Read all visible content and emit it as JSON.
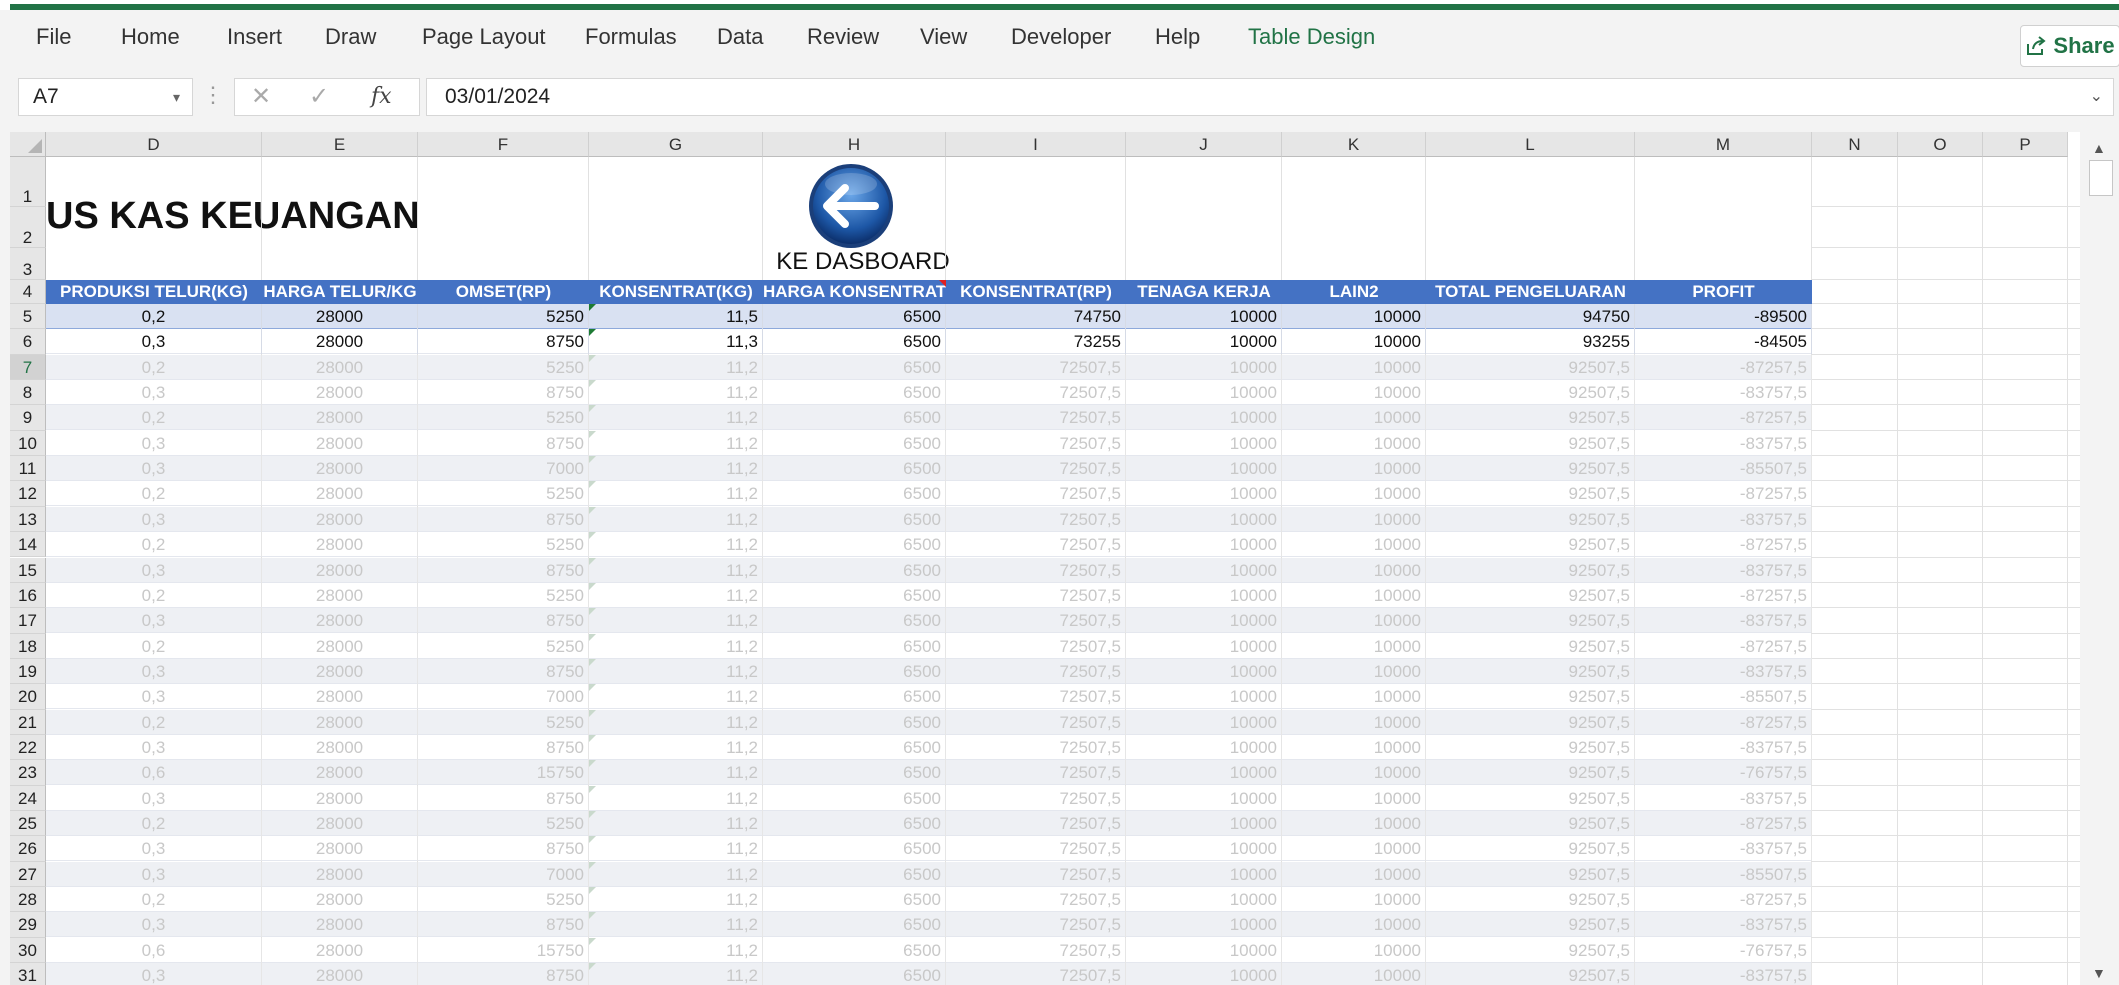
{
  "ribbon": {
    "tabs": [
      "File",
      "Home",
      "Insert",
      "Draw",
      "Page Layout",
      "Formulas",
      "Data",
      "Review",
      "View",
      "Developer",
      "Help",
      "Table Design"
    ],
    "share_label": "Share",
    "accent": "#217346"
  },
  "formula_bar": {
    "name_box": "A7",
    "fx": "fx",
    "formula": "03/01/2024"
  },
  "columns": [
    "D",
    "E",
    "F",
    "G",
    "H",
    "I",
    "J",
    "K",
    "L",
    "M",
    "N",
    "O",
    "P"
  ],
  "sheet": {
    "title": "US KAS KEUANGAN",
    "dashboard_button_label": "KE DASBOARD",
    "headers": [
      "PRODUKSI TELUR(KG)",
      "HARGA TELUR/KG",
      "OMSET(RP)",
      "KONSENTRAT(KG)",
      "HARGA KONSENTRAT",
      "KONSENTRAT(RP)",
      "TENAGA KERJA",
      "LAIN2",
      "TOTAL PENGELUARAN",
      "PROFIT"
    ],
    "rows": [
      {
        "n": "1"
      },
      {
        "n": "2"
      },
      {
        "n": "3"
      },
      {
        "n": "4"
      },
      {
        "n": "5",
        "v": [
          "0,2",
          "28000",
          "5250",
          "11,5",
          "6500",
          "74750",
          "10000",
          "10000",
          "94750",
          "-89500"
        ]
      },
      {
        "n": "6",
        "v": [
          "0,3",
          "28000",
          "8750",
          "11,3",
          "6500",
          "73255",
          "10000",
          "10000",
          "93255",
          "-84505"
        ]
      },
      {
        "n": "7",
        "v": [
          "0,2",
          "28000",
          "5250",
          "11,2",
          "6500",
          "72507,5",
          "10000",
          "10000",
          "92507,5",
          "-87257,5"
        ]
      },
      {
        "n": "8",
        "v": [
          "0,3",
          "28000",
          "8750",
          "11,2",
          "6500",
          "72507,5",
          "10000",
          "10000",
          "92507,5",
          "-83757,5"
        ]
      },
      {
        "n": "9",
        "v": [
          "0,2",
          "28000",
          "5250",
          "11,2",
          "6500",
          "72507,5",
          "10000",
          "10000",
          "92507,5",
          "-87257,5"
        ]
      },
      {
        "n": "10",
        "v": [
          "0,3",
          "28000",
          "8750",
          "11,2",
          "6500",
          "72507,5",
          "10000",
          "10000",
          "92507,5",
          "-83757,5"
        ]
      },
      {
        "n": "11",
        "v": [
          "0,3",
          "28000",
          "7000",
          "11,2",
          "6500",
          "72507,5",
          "10000",
          "10000",
          "92507,5",
          "-85507,5"
        ]
      },
      {
        "n": "12",
        "v": [
          "0,2",
          "28000",
          "5250",
          "11,2",
          "6500",
          "72507,5",
          "10000",
          "10000",
          "92507,5",
          "-87257,5"
        ]
      },
      {
        "n": "13",
        "v": [
          "0,3",
          "28000",
          "8750",
          "11,2",
          "6500",
          "72507,5",
          "10000",
          "10000",
          "92507,5",
          "-83757,5"
        ]
      },
      {
        "n": "14",
        "v": [
          "0,2",
          "28000",
          "5250",
          "11,2",
          "6500",
          "72507,5",
          "10000",
          "10000",
          "92507,5",
          "-87257,5"
        ]
      },
      {
        "n": "15",
        "v": [
          "0,3",
          "28000",
          "8750",
          "11,2",
          "6500",
          "72507,5",
          "10000",
          "10000",
          "92507,5",
          "-83757,5"
        ]
      },
      {
        "n": "16",
        "v": [
          "0,2",
          "28000",
          "5250",
          "11,2",
          "6500",
          "72507,5",
          "10000",
          "10000",
          "92507,5",
          "-87257,5"
        ]
      },
      {
        "n": "17",
        "v": [
          "0,3",
          "28000",
          "8750",
          "11,2",
          "6500",
          "72507,5",
          "10000",
          "10000",
          "92507,5",
          "-83757,5"
        ]
      },
      {
        "n": "18",
        "v": [
          "0,2",
          "28000",
          "5250",
          "11,2",
          "6500",
          "72507,5",
          "10000",
          "10000",
          "92507,5",
          "-87257,5"
        ]
      },
      {
        "n": "19",
        "v": [
          "0,3",
          "28000",
          "8750",
          "11,2",
          "6500",
          "72507,5",
          "10000",
          "10000",
          "92507,5",
          "-83757,5"
        ]
      },
      {
        "n": "20",
        "v": [
          "0,3",
          "28000",
          "7000",
          "11,2",
          "6500",
          "72507,5",
          "10000",
          "10000",
          "92507,5",
          "-85507,5"
        ]
      },
      {
        "n": "21",
        "v": [
          "0,2",
          "28000",
          "5250",
          "11,2",
          "6500",
          "72507,5",
          "10000",
          "10000",
          "92507,5",
          "-87257,5"
        ]
      },
      {
        "n": "22",
        "v": [
          "0,3",
          "28000",
          "8750",
          "11,2",
          "6500",
          "72507,5",
          "10000",
          "10000",
          "92507,5",
          "-83757,5"
        ]
      },
      {
        "n": "23",
        "v": [
          "0,6",
          "28000",
          "15750",
          "11,2",
          "6500",
          "72507,5",
          "10000",
          "10000",
          "92507,5",
          "-76757,5"
        ]
      },
      {
        "n": "24",
        "v": [
          "0,3",
          "28000",
          "8750",
          "11,2",
          "6500",
          "72507,5",
          "10000",
          "10000",
          "92507,5",
          "-83757,5"
        ]
      },
      {
        "n": "25",
        "v": [
          "0,2",
          "28000",
          "5250",
          "11,2",
          "6500",
          "72507,5",
          "10000",
          "10000",
          "92507,5",
          "-87257,5"
        ]
      },
      {
        "n": "26",
        "v": [
          "0,3",
          "28000",
          "8750",
          "11,2",
          "6500",
          "72507,5",
          "10000",
          "10000",
          "92507,5",
          "-83757,5"
        ]
      },
      {
        "n": "27",
        "v": [
          "0,3",
          "28000",
          "7000",
          "11,2",
          "6500",
          "72507,5",
          "10000",
          "10000",
          "92507,5",
          "-85507,5"
        ]
      },
      {
        "n": "28",
        "v": [
          "0,2",
          "28000",
          "5250",
          "11,2",
          "6500",
          "72507,5",
          "10000",
          "10000",
          "92507,5",
          "-87257,5"
        ]
      },
      {
        "n": "29",
        "v": [
          "0,3",
          "28000",
          "8750",
          "11,2",
          "6500",
          "72507,5",
          "10000",
          "10000",
          "92507,5",
          "-83757,5"
        ]
      },
      {
        "n": "30",
        "v": [
          "0,6",
          "28000",
          "15750",
          "11,2",
          "6500",
          "72507,5",
          "10000",
          "10000",
          "92507,5",
          "-76757,5"
        ]
      },
      {
        "n": "31",
        "v": [
          "0,3",
          "28000",
          "8750",
          "11,2",
          "6500",
          "72507,5",
          "10000",
          "10000",
          "92507,5",
          "-83757,5"
        ]
      }
    ]
  },
  "colors": {
    "header_fill": "#4472c4",
    "band_fill": "#d9e1f2",
    "faint_text": "#c8c8c8"
  }
}
